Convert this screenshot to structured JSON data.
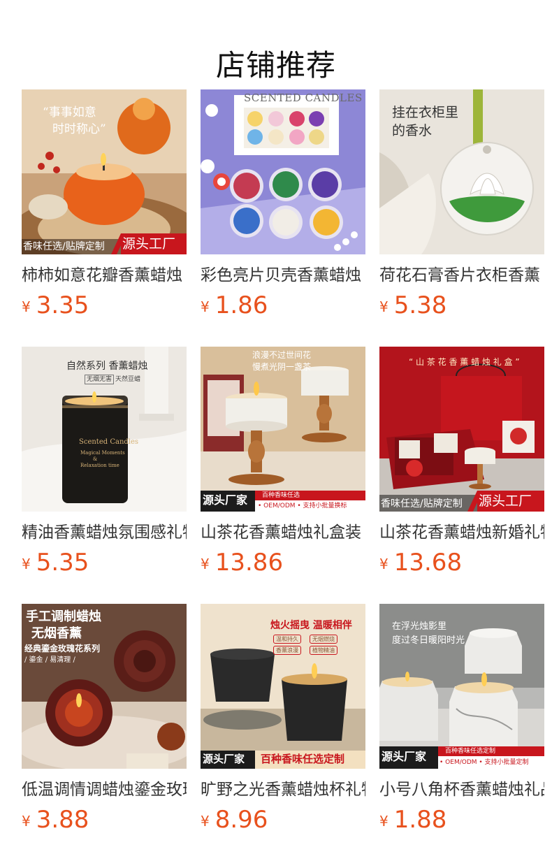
{
  "header": {
    "title": "店铺推荐"
  },
  "colors": {
    "price": "#e8511d",
    "badge_red": "#c8161d"
  },
  "products": [
    {
      "name": "柿柿如意花瓣香薰蜡烛",
      "currency": "¥",
      "price": "3.35",
      "image": {
        "icon": "persimmon-candle-image",
        "text_lines": [
          "“事事如意",
          "时时称心”"
        ],
        "badge_left": "香味任选/贴牌定制",
        "badge_right": "源头工厂"
      }
    },
    {
      "name": "彩色亮片贝壳香薰蜡烛",
      "currency": "¥",
      "price": "1.86",
      "image": {
        "icon": "shell-tealight-candles-image",
        "text_lines": [
          "SCENTED CANDLES"
        ]
      }
    },
    {
      "name": "荷花石膏香片衣柜香薰",
      "currency": "¥",
      "price": "5.38",
      "image": {
        "icon": "lotus-plaster-sachet-image",
        "text_lines": [
          "挂在衣柜里",
          "的香水"
        ]
      }
    },
    {
      "name": "精油香薰蜡烛氛围感礼物",
      "currency": "¥",
      "price": "5.35",
      "image": {
        "icon": "black-jar-candle-image",
        "text_lines": [
          "自然系列 香薰蜡烛",
          "无烟无害",
          "天然豆蜡",
          "Scented Candles",
          "Magical Moments",
          "&",
          "Relaxation time"
        ]
      }
    },
    {
      "name": "山茶花香薰蜡烛礼盒装",
      "currency": "¥",
      "price": "13.86",
      "image": {
        "icon": "wooden-stand-candle-image",
        "text_lines": [
          "浪漫不过世间花",
          "慢煮光阴一盏茶"
        ],
        "badge_left": "源头厂家",
        "badge_right_top": "百种香味任选",
        "badge_right_bottom": "• OEM/ODM • 支持小批量换标"
      }
    },
    {
      "name": "山茶花香薰蜡烛新婚礼物",
      "currency": "¥",
      "price": "13.68",
      "image": {
        "icon": "camellia-gift-box-image",
        "text_lines": [
          "“ 山 茶 花 香 薰 蜡 烛 礼 盒 ”"
        ],
        "badge_left": "香味任选/贴牌定制",
        "badge_right": "源头工厂"
      }
    },
    {
      "name": "低温调情调蜡烛鎏金玫瑰",
      "currency": "¥",
      "price": "3.88",
      "image": {
        "icon": "rose-shaped-candle-image",
        "text_lines": [
          "手工调制蜡烛",
          "无烟香薰",
          "经典鎏金玫瑰花系列",
          "/ 鎏金 / 易清理 /"
        ]
      }
    },
    {
      "name": "旷野之光香薰蜡烛杯礼物",
      "currency": "¥",
      "price": "8.96",
      "image": {
        "icon": "black-ceramic-candle-image",
        "text_lines": [
          "烛火摇曳 温暖相伴",
          "温和持久",
          "无烟燃烧",
          "香薰浪漫",
          "植物精油"
        ],
        "badge_left": "源头厂家",
        "badge_right": "百种香味任选定制"
      }
    },
    {
      "name": "小号八角杯香薰蜡烛礼品",
      "currency": "¥",
      "price": "1.88",
      "image": {
        "icon": "marble-octagon-candle-image",
        "text_lines": [
          "在浮光烛影里",
          "度过冬日暖阳时光"
        ],
        "badge_left": "源头厂家",
        "badge_right_top": "百种香味任选定制",
        "badge_right_bottom": "• OEM/ODM • 支持小批量定制"
      }
    }
  ]
}
